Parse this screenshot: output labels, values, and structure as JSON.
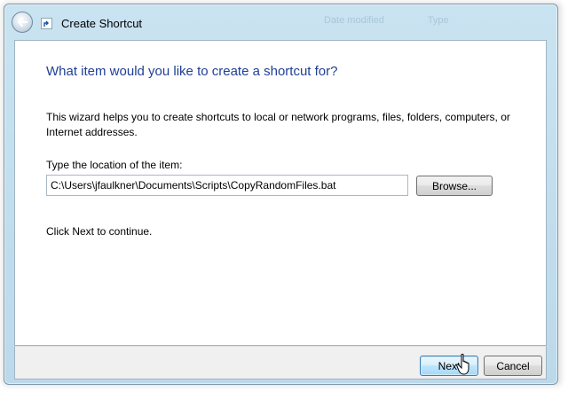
{
  "window": {
    "title": "Create Shortcut",
    "background_headers": [
      "Date modified",
      "Type"
    ]
  },
  "page": {
    "heading": "What item would you like to create a shortcut for?",
    "description": "This wizard helps you to create shortcuts to local or network programs, files, folders, computers, or Internet addresses.",
    "location_label": "Type the location of the item:",
    "location_value": "C:\\Users\\jfaulkner\\Documents\\Scripts\\CopyRandomFiles.bat",
    "browse_label": "Browse...",
    "continue_text": "Click Next to continue."
  },
  "footer": {
    "next_label": "Next",
    "cancel_label": "Cancel"
  },
  "colors": {
    "heading": "#1f3f96",
    "frame": "#bcd9ea",
    "next_button_border": "#3c7fb1"
  },
  "icons": [
    "back-arrow-icon",
    "shortcut-icon",
    "mouse-cursor-icon"
  ]
}
